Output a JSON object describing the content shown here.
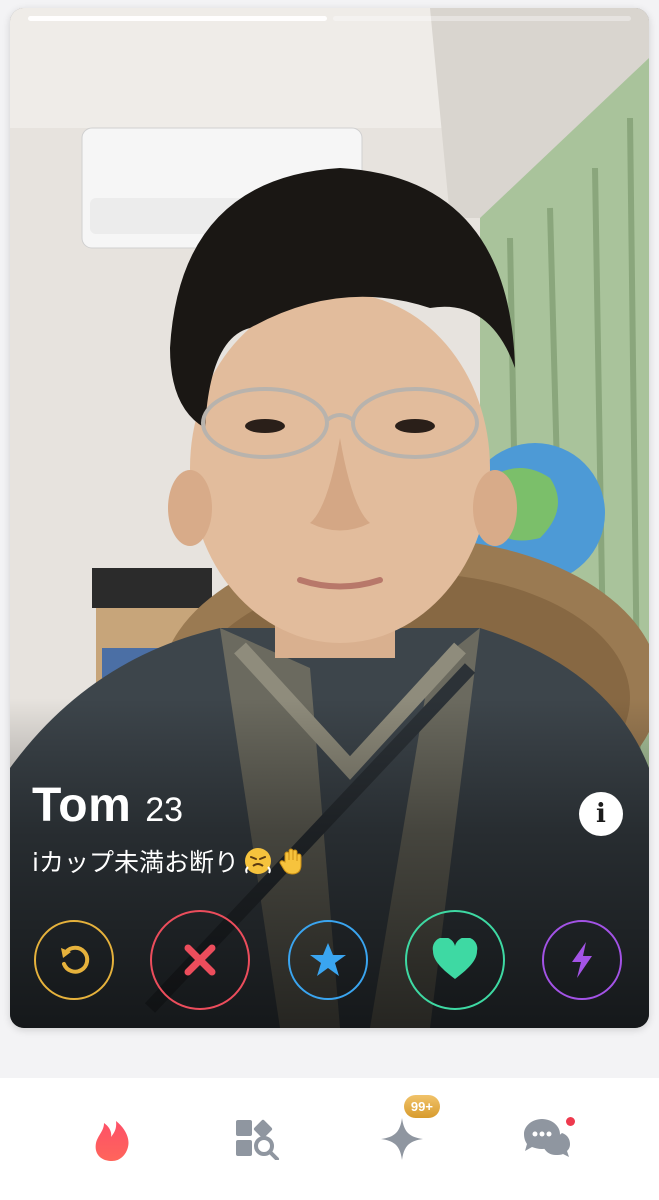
{
  "profile": {
    "name": "Tom",
    "age": "23",
    "bio": "iカップ未満お断り",
    "info_label": "i"
  },
  "progress": {
    "segments": 2,
    "active_index": 0
  },
  "actions": [
    {
      "name": "rewind",
      "icon": "rewind-icon",
      "color": "#e6b23c"
    },
    {
      "name": "nope",
      "icon": "close-icon",
      "color": "#ec4d5c"
    },
    {
      "name": "super-like",
      "icon": "star-icon",
      "color": "#3aa5f0"
    },
    {
      "name": "like",
      "icon": "heart-icon",
      "color": "#3ed9a3"
    },
    {
      "name": "boost",
      "icon": "lightning-icon",
      "color": "#a353e6"
    }
  ],
  "nav": {
    "items": [
      {
        "name": "home",
        "icon": "flame-icon",
        "active": true
      },
      {
        "name": "explore",
        "icon": "explore-grid-icon"
      },
      {
        "name": "likes",
        "icon": "sparkle-icon",
        "badge": "99+"
      },
      {
        "name": "chat",
        "icon": "chat-bubbles-icon",
        "dot": true
      }
    ]
  }
}
